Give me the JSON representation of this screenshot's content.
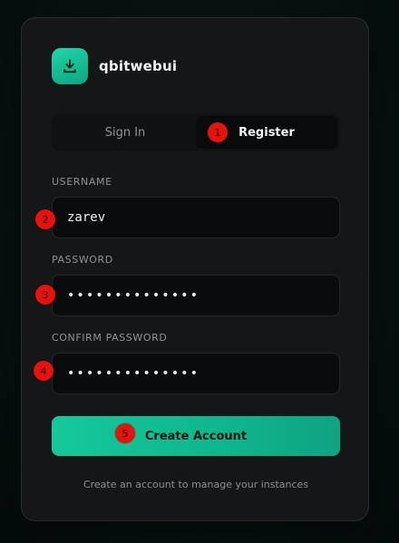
{
  "brand": {
    "name": "qbitwebui",
    "icon": "download-icon",
    "accent": "#14c99b"
  },
  "tabs": [
    {
      "label": "Sign In",
      "active": false
    },
    {
      "label": "Register",
      "active": true
    }
  ],
  "form": {
    "username": {
      "label": "USERNAME",
      "value": "zarev"
    },
    "password": {
      "label": "PASSWORD",
      "value": "••••••••••••••"
    },
    "confirm_password": {
      "label": "CONFIRM PASSWORD",
      "value": "••••••••••••••"
    },
    "submit_label": "Create Account"
  },
  "footer": {
    "hint": "Create an account to manage your instances"
  },
  "markers": [
    "1",
    "2",
    "3",
    "4",
    "5"
  ]
}
